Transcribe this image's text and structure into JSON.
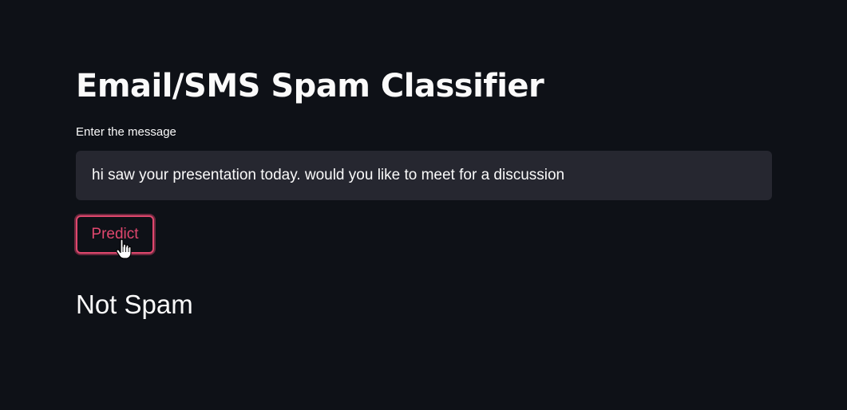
{
  "app": {
    "title": "Email/SMS Spam Classifier"
  },
  "form": {
    "input_label": "Enter the message",
    "input_value": "hi saw your presentation today. would you like to meet for a discussion",
    "predict_label": "Predict"
  },
  "result": {
    "text": "Not Spam"
  },
  "colors": {
    "background": "#0e1117",
    "input_background": "#262730",
    "accent": "#e0476e",
    "text": "#fafafa"
  },
  "icons": {
    "cursor": "hand-pointer-icon"
  }
}
